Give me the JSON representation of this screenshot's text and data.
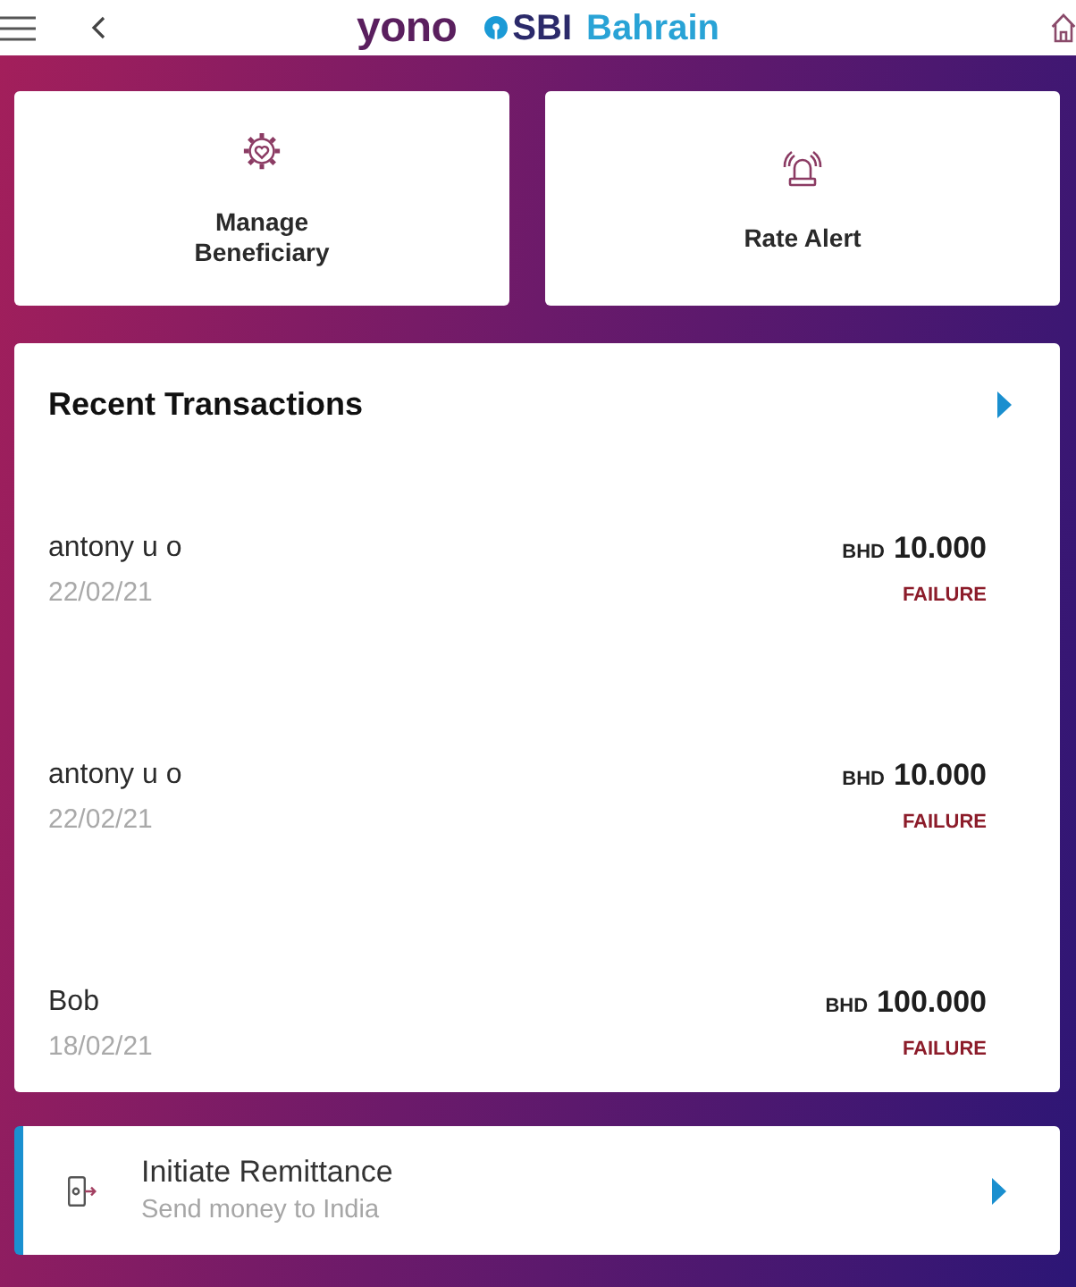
{
  "header": {
    "brand": "yono",
    "bank": "SBI",
    "region": "Bahrain"
  },
  "quick_actions": [
    {
      "kind": "beneficiary",
      "label": "Manage Beneficiary"
    },
    {
      "kind": "alert",
      "label": "Rate Alert"
    }
  ],
  "recent_transactions": {
    "title": "Recent Transactions",
    "items": [
      {
        "name": "antony u o",
        "date": "22/02/21",
        "currency": "BHD",
        "amount": "10.000",
        "status": "FAILURE"
      },
      {
        "name": "antony u o",
        "date": "22/02/21",
        "currency": "BHD",
        "amount": "10.000",
        "status": "FAILURE"
      },
      {
        "name": "Bob",
        "date": "18/02/21",
        "currency": "BHD",
        "amount": "100.000",
        "status": "FAILURE"
      }
    ]
  },
  "remittance": {
    "title": "Initiate Remittance",
    "subtitle": "Send money to India"
  }
}
